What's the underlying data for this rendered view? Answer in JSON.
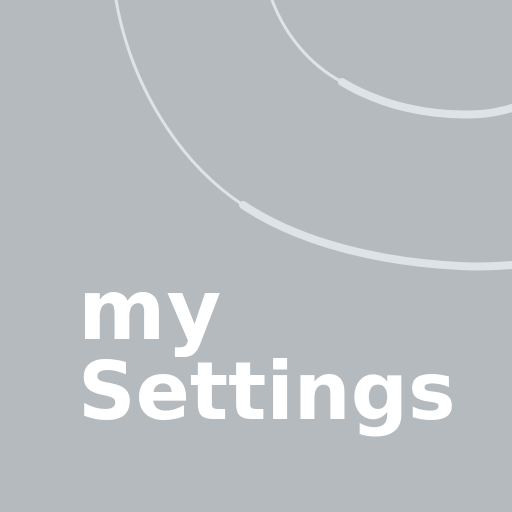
{
  "app_icon": {
    "name_line_1": "my",
    "name_line_2": "Settings",
    "background_color": "#b4babe",
    "text_color": "#ffffff",
    "arc_color": "#dfe3e6"
  }
}
